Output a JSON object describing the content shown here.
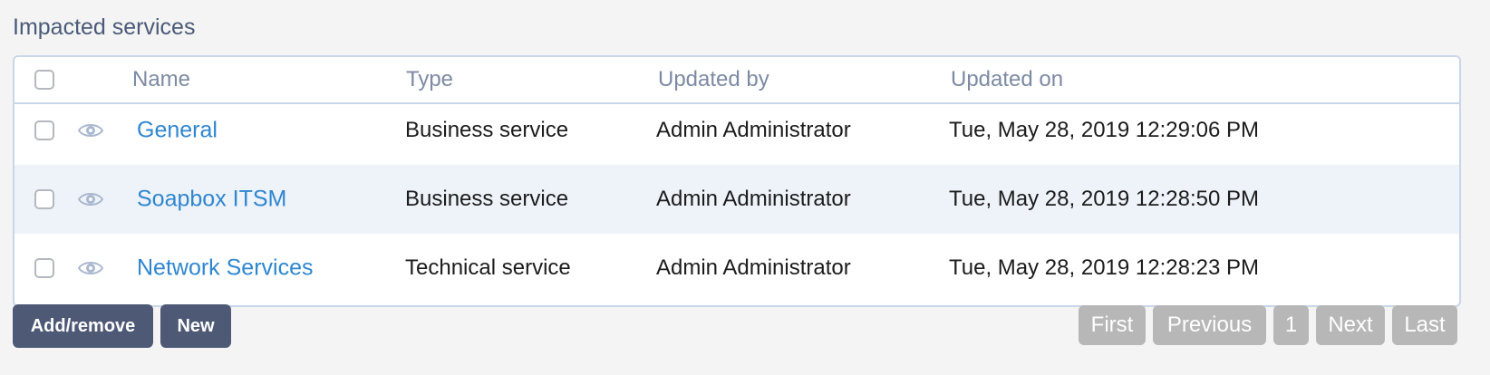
{
  "section": {
    "title": "Impacted services"
  },
  "table": {
    "headers": {
      "name": "Name",
      "type": "Type",
      "updated_by": "Updated by",
      "updated_on": "Updated on"
    },
    "rows": [
      {
        "name": "General",
        "type": "Business service",
        "updated_by": "Admin Administrator",
        "updated_on": "Tue, May 28, 2019 12:29:06 PM"
      },
      {
        "name": "Soapbox ITSM",
        "type": "Business service",
        "updated_by": "Admin Administrator",
        "updated_on": "Tue, May 28, 2019 12:28:50 PM"
      },
      {
        "name": "Network Services",
        "type": "Technical service",
        "updated_by": "Admin Administrator",
        "updated_on": "Tue, May 28, 2019 12:28:23 PM"
      }
    ]
  },
  "actions": {
    "add_remove": "Add/remove",
    "new": "New"
  },
  "pagination": {
    "first": "First",
    "previous": "Previous",
    "page": "1",
    "next": "Next",
    "last": "Last"
  },
  "icons": {
    "row_view": "eye-icon"
  },
  "colors": {
    "link": "#2f86d0",
    "button": "#4d5975",
    "pager_disabled": "#b7b7b7",
    "header_text": "#7c8aa3",
    "alt_row": "#eef3f9"
  }
}
